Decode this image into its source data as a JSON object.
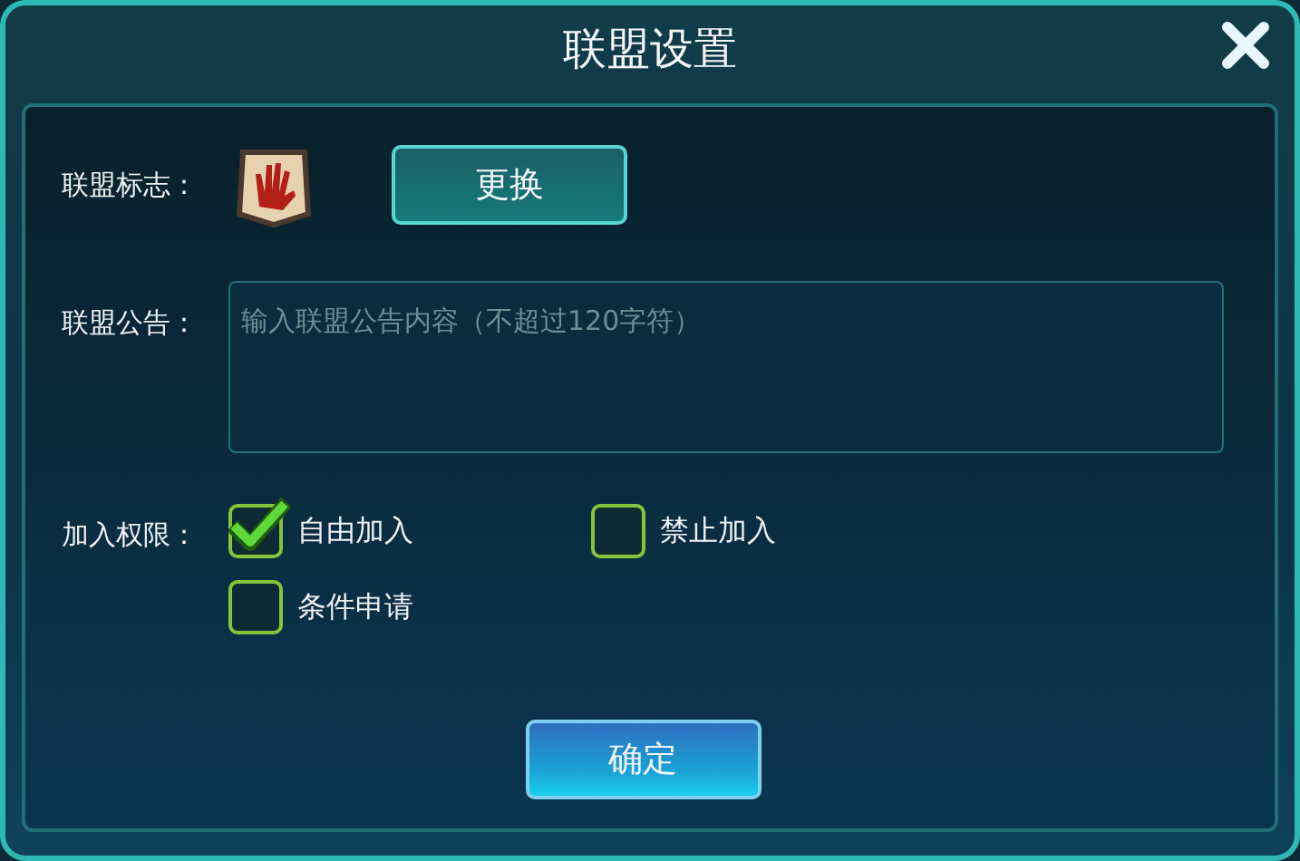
{
  "window": {
    "title": "联盟设置"
  },
  "emblem": {
    "label": "联盟标志：",
    "button": "更换"
  },
  "notice": {
    "label": "联盟公告：",
    "placeholder": "输入联盟公告内容（不超过120字符）"
  },
  "permission": {
    "label": "加入权限：",
    "options": [
      {
        "label": "自由加入",
        "selected": true
      },
      {
        "label": "禁止加入",
        "selected": false
      },
      {
        "label": "条件申请",
        "selected": false
      }
    ]
  },
  "confirm": "确定"
}
